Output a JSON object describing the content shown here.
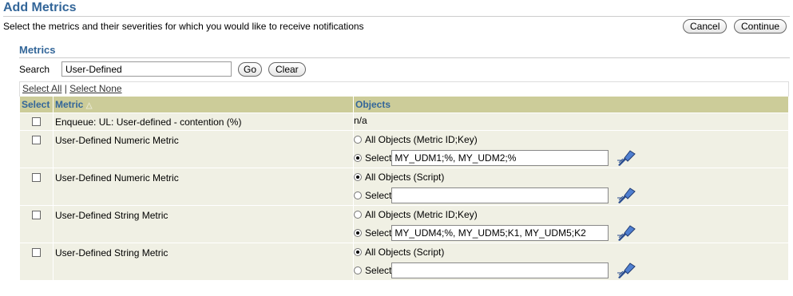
{
  "page": {
    "title": "Add Metrics",
    "description": "Select the metrics and their severities for which you would like to receive notifications",
    "cancel_label": "Cancel",
    "continue_label": "Continue"
  },
  "metrics_section": {
    "title": "Metrics",
    "search_label": "Search",
    "search_value": "User-Defined",
    "go_label": "Go",
    "clear_label": "Clear",
    "select_all": "Select All",
    "separator": "|",
    "select_none": "Select None",
    "columns": {
      "select": "Select",
      "metric": "Metric",
      "objects": "Objects"
    },
    "rows": [
      {
        "metric": "Enqueue: UL: User-defined - contention (%)",
        "objects": "n/a"
      },
      {
        "metric": "User-Defined Numeric Metric",
        "opt1": "All Objects (Metric ID;Key)",
        "opt2": "Select",
        "value": "MY_UDM1;%, MY_UDM2;%"
      },
      {
        "metric": "User-Defined Numeric Metric",
        "opt1": "All Objects (Script)",
        "opt2": "Select",
        "value": ""
      },
      {
        "metric": "User-Defined String Metric",
        "opt1": "All Objects (Metric ID;Key)",
        "opt2": "Select",
        "value": "MY_UDM4;%, MY_UDM5;K1, MY_UDM5;K2"
      },
      {
        "metric": "User-Defined String Metric",
        "opt1": "All Objects (Script)",
        "opt2": "Select",
        "value": ""
      }
    ]
  },
  "colors": {
    "accent": "#336699",
    "header_bg": "#cccc99",
    "row_bg": "#f0f0e4"
  },
  "icons": {
    "flashlight": "flashlight-search-icon",
    "sort": "sort-ascending-icon"
  }
}
